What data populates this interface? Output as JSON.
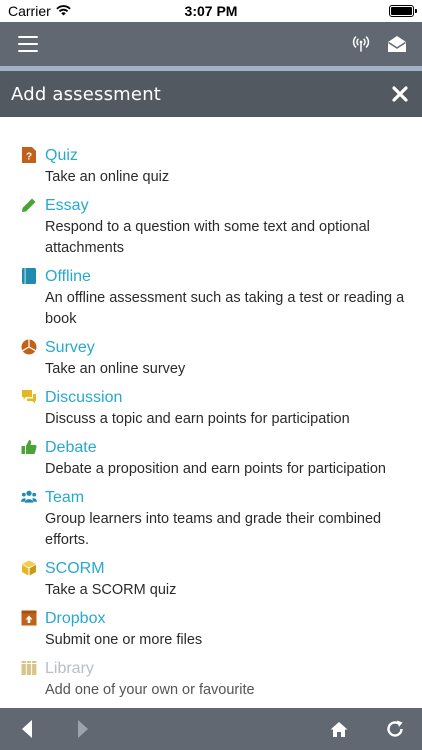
{
  "status_bar": {
    "carrier": "Carrier",
    "time": "3:07 PM"
  },
  "header": {
    "menu_icon": "hamburger-icon",
    "right_icons": [
      "signal-icon",
      "mail-open-icon"
    ]
  },
  "page": {
    "title": "Add assessment",
    "close_icon": "close-icon"
  },
  "items": [
    {
      "icon": "quiz-icon",
      "icon_color": "#c0621a",
      "title": "Quiz",
      "description": "Take an online quiz"
    },
    {
      "icon": "pencil-icon",
      "icon_color": "#4aa336",
      "title": "Essay",
      "description": "Respond to a question with some text and optional attachments"
    },
    {
      "icon": "book-icon",
      "icon_color": "#1f8bb0",
      "title": "Offline",
      "description": "An offline assessment such as taking a test or reading a book"
    },
    {
      "icon": "pie-chart-icon",
      "icon_color": "#c0621a",
      "title": "Survey",
      "description": "Take an online survey"
    },
    {
      "icon": "chat-bubbles-icon",
      "icon_color": "#e4b820",
      "title": "Discussion",
      "description": "Discuss a topic and earn points for participation"
    },
    {
      "icon": "thumbs-up-icon",
      "icon_color": "#4aa336",
      "title": "Debate",
      "description": "Debate a proposition and earn points for participation"
    },
    {
      "icon": "team-icon",
      "icon_color": "#1f8bb0",
      "title": "Team",
      "description": "Group learners into teams and grade their combined efforts."
    },
    {
      "icon": "cube-icon",
      "icon_color": "#e4b820",
      "title": "SCORM",
      "description": "Take a SCORM quiz"
    },
    {
      "icon": "dropbox-icon",
      "icon_color": "#c0621a",
      "title": "Dropbox",
      "description": "Submit one or more files"
    },
    {
      "icon": "library-icon",
      "icon_color": "#d8c58a",
      "title": "Library",
      "description": "Add one of your own or favourite",
      "disabled": true
    }
  ],
  "bottom_bar": {
    "icons": [
      "back-arrow-icon",
      "forward-arrow-icon",
      "home-icon",
      "refresh-icon"
    ]
  }
}
